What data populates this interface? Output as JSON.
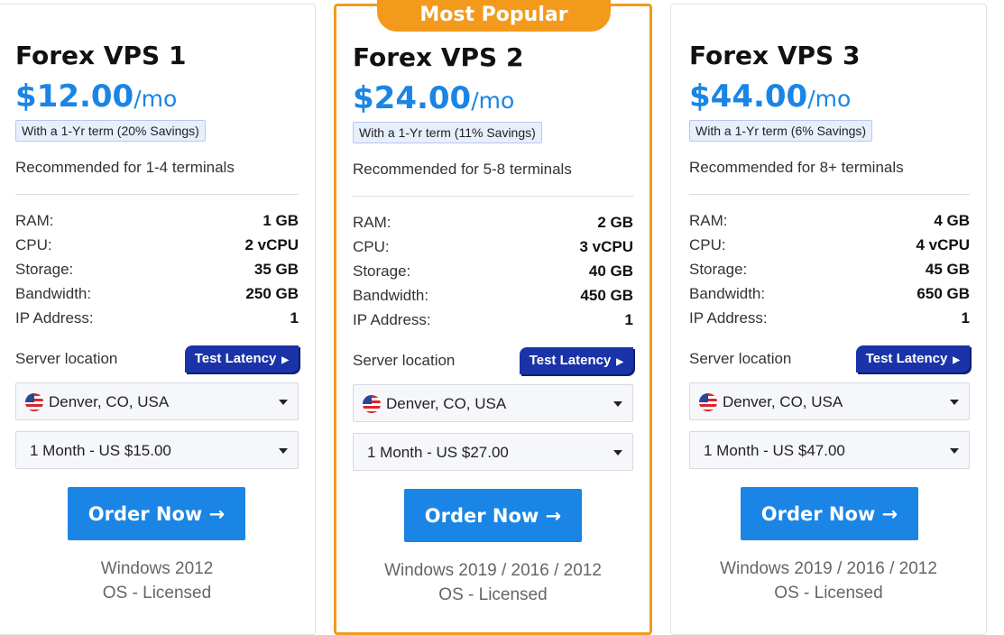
{
  "badge": "Most Popular",
  "specs_labels": {
    "ram": "RAM:",
    "cpu": "CPU:",
    "storage": "Storage:",
    "bandwidth": "Bandwidth:",
    "ip": "IP Address:"
  },
  "location_label": "Server location",
  "latency_label": "Test Latency",
  "order_label": "Order Now →",
  "colors": {
    "accent": "#1a85e5",
    "popular": "#f39a1c",
    "latency": "#1a33a8"
  },
  "plans": [
    {
      "title": "Forex VPS 1",
      "price": "$12.00",
      "period": "/mo",
      "term": "With a 1-Yr term (20% Savings)",
      "recommended": "Recommended for 1-4 terminals",
      "ram": "1 GB",
      "cpu": "2 vCPU",
      "storage": "35 GB",
      "bandwidth": "250 GB",
      "ip": "1",
      "location": "Denver, CO, USA",
      "billing": "1 Month - US $15.00",
      "os_line1": "Windows 2012",
      "os_line2": "OS - Licensed"
    },
    {
      "title": "Forex VPS 2",
      "price": "$24.00",
      "period": "/mo",
      "term": "With a 1-Yr term (11% Savings)",
      "recommended": "Recommended for 5-8 terminals",
      "ram": "2 GB",
      "cpu": "3 vCPU",
      "storage": "40 GB",
      "bandwidth": "450 GB",
      "ip": "1",
      "location": "Denver, CO, USA",
      "billing": "1 Month - US $27.00",
      "os_line1": "Windows 2019 / 2016 / 2012",
      "os_line2": "OS - Licensed"
    },
    {
      "title": "Forex VPS 3",
      "price": "$44.00",
      "period": "/mo",
      "term": "With a 1-Yr term (6% Savings)",
      "recommended": "Recommended for 8+ terminals",
      "ram": "4 GB",
      "cpu": "4 vCPU",
      "storage": "45 GB",
      "bandwidth": "650 GB",
      "ip": "1",
      "location": "Denver, CO, USA",
      "billing": "1 Month - US $47.00",
      "os_line1": "Windows 2019 / 2016 / 2012",
      "os_line2": "OS - Licensed"
    }
  ]
}
